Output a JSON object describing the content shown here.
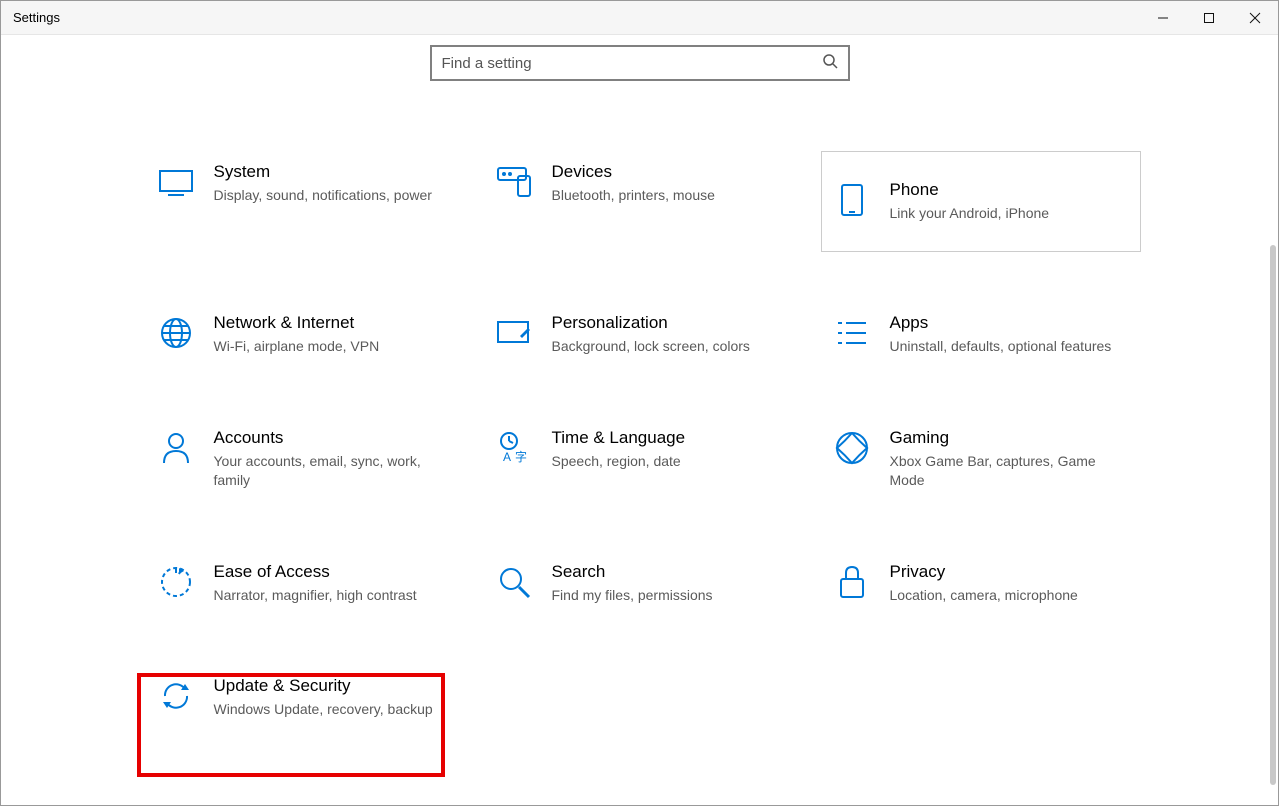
{
  "window": {
    "title": "Settings"
  },
  "search": {
    "placeholder": "Find a setting"
  },
  "categories": [
    {
      "id": "system",
      "title": "System",
      "desc": "Display, sound, notifications, power"
    },
    {
      "id": "devices",
      "title": "Devices",
      "desc": "Bluetooth, printers, mouse"
    },
    {
      "id": "phone",
      "title": "Phone",
      "desc": "Link your Android, iPhone",
      "hovered": true
    },
    {
      "id": "network",
      "title": "Network & Internet",
      "desc": "Wi-Fi, airplane mode, VPN"
    },
    {
      "id": "personalization",
      "title": "Personalization",
      "desc": "Background, lock screen, colors"
    },
    {
      "id": "apps",
      "title": "Apps",
      "desc": "Uninstall, defaults, optional features"
    },
    {
      "id": "accounts",
      "title": "Accounts",
      "desc": "Your accounts, email, sync, work, family"
    },
    {
      "id": "time",
      "title": "Time & Language",
      "desc": "Speech, region, date"
    },
    {
      "id": "gaming",
      "title": "Gaming",
      "desc": "Xbox Game Bar, captures, Game Mode"
    },
    {
      "id": "ease",
      "title": "Ease of Access",
      "desc": "Narrator, magnifier, high contrast"
    },
    {
      "id": "search",
      "title": "Search",
      "desc": "Find my files, permissions"
    },
    {
      "id": "privacy",
      "title": "Privacy",
      "desc": "Location, camera, microphone"
    },
    {
      "id": "update",
      "title": "Update & Security",
      "desc": "Windows Update, recovery, backup",
      "highlighted": true
    }
  ],
  "colors": {
    "accent": "#0078d7",
    "highlight": "#e60000"
  }
}
